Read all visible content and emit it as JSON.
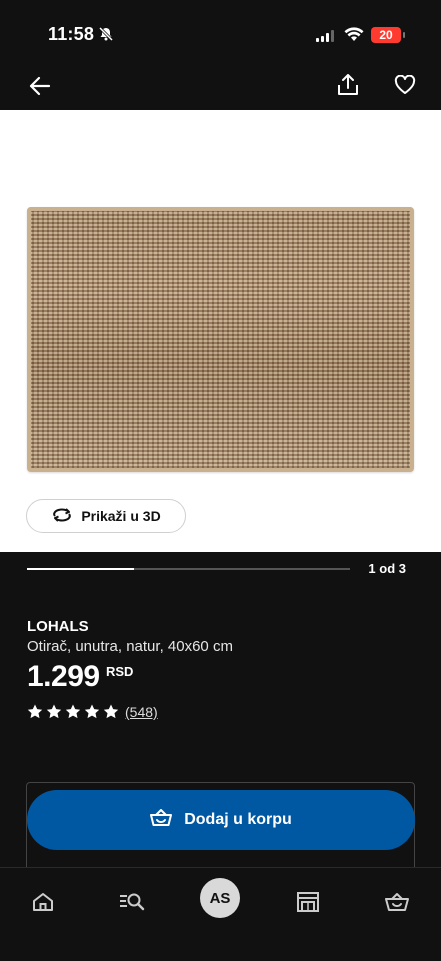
{
  "status_bar": {
    "time": "11:58",
    "battery": "20"
  },
  "gallery": {
    "view_3d_label": "Prikaži u 3D",
    "pager": "1 od 3",
    "progress": 0.33
  },
  "product": {
    "name": "LOHALS",
    "description": "Otirač, unutra, natur, 40x60 cm",
    "price": "1.299",
    "currency": "RSD",
    "rating": 5,
    "reviews": "(548)"
  },
  "cart": {
    "add_label": "Dodaj u korpu"
  },
  "bottom_nav": {
    "avatar_initials": "AS"
  },
  "colors": {
    "accent": "#0058a3",
    "background": "#111111",
    "battery": "#ff3b30"
  }
}
